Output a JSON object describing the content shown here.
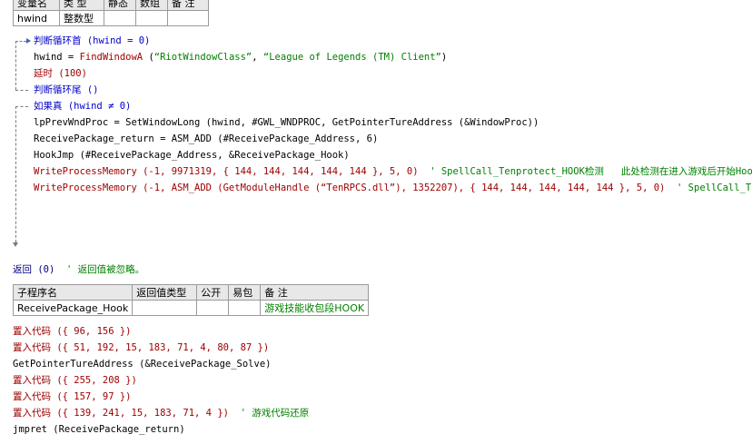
{
  "var_table": {
    "headers": [
      "变量名",
      "类 型",
      "静态",
      "数组",
      "备 注"
    ],
    "row": [
      "hwind",
      "整数型",
      "",
      "",
      ""
    ]
  },
  "code": {
    "loop_start": "判断循环首 (hwind = 0)",
    "line_find": "hwind = FindWindowA (“RiotWindowClass”, “League of Legends (TM) Client”)",
    "line_delay": "延时 (100)",
    "loop_end": "判断循环尾 ()",
    "if_true": "如果真 (hwind ≠ 0)",
    "line_setwindow": "lpPrevWndProc = SetWindowLong (hwind, #GWL_WNDPROC, GetPointerTureAddress (&WindowProc))",
    "line_receive": "ReceivePackage_return = ASM_ADD (#ReceivePackage_Address, 6)",
    "line_hookjmp": "HookJmp (#ReceivePackage_Address, &ReceivePackage_Hook)",
    "line_write1": "WriteProcessMemory (-1, 9971319, { 144, 144, 144, 144, 144 }, 5, 0)",
    "line_write1_comment": "' SpellCall_Tenprotect_HOOK检测   此处检测在进入游戏后开始Hook",
    "line_write2": "WriteProcessMemory (-1, ASM_ADD (GetModuleHandle (“TenRPCS.dll”), 1352207), { 144, 144, 144, 144, 144 }, 5, 0)",
    "line_write2_comment": "' SpellCall_Tenpro",
    "line_return": "返回 (0)",
    "line_return_comment": "' 返回值被忽略。"
  },
  "sub_table": {
    "headers": [
      "子程序名",
      "返回值类型",
      "公开",
      "易包",
      "备 注"
    ],
    "row": [
      "ReceivePackage_Hook",
      "",
      "",
      "",
      "游戏技能收包段HOOK"
    ]
  },
  "sub_code": {
    "l1": "置入代码 ({ 96, 156 })",
    "l2": "置入代码 ({ 51, 192, 15, 183, 71, 4, 80, 87 })",
    "l3": "GetPointerTureAddress (&ReceivePackage_Solve)",
    "l4": "置入代码 ({ 255, 208 })",
    "l5": "置入代码 ({ 157, 97 })",
    "l6": "置入代码 ({ 139, 241, 15, 183, 71, 4 })",
    "l6_comment": "' 游戏代码还原",
    "l7": "jmpret (ReceivePackage_return)"
  }
}
